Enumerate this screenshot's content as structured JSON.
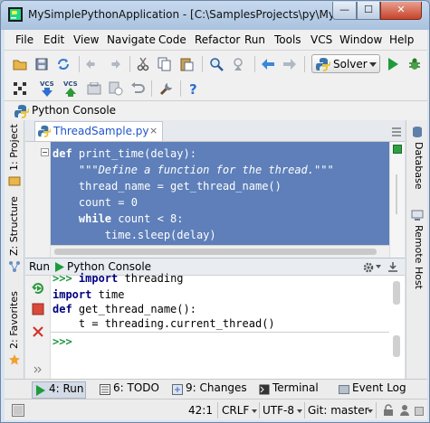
{
  "window": {
    "title": "MySimplePythonApplication - [C:\\SamplesProjects\\py\\MySim...",
    "minimize_label": "—",
    "maximize_label": "☐",
    "close_label": "✕"
  },
  "menu": [
    "File",
    "Edit",
    "View",
    "Navigate",
    "Code",
    "Refactor",
    "Run",
    "Tools",
    "VCS",
    "Window",
    "Help"
  ],
  "toolbar": {
    "run_config": "Solver",
    "vcs_label": "VCS"
  },
  "navbar": {
    "crumb": "Python Console"
  },
  "side_tabs": {
    "left": [
      "1: Project",
      "Z: Structure",
      "2: Favorites"
    ],
    "right": [
      "Database",
      "Remote Host"
    ]
  },
  "editor": {
    "tab_label": "ThreadSample.py",
    "tab_close": "×",
    "lines": [
      {
        "kw": "def",
        "rest": " print_time(delay):"
      },
      {
        "indent": "    ",
        "doc": "\"\"\"Define a function for the thread.\"\"\""
      },
      {
        "text": "    thread_name = get_thread_name()"
      },
      {
        "text": "    count = 0"
      },
      {
        "kw_indent": "    ",
        "kw": "while",
        "rest": " count < 8:"
      },
      {
        "text": "        time.sleep(delay)"
      }
    ]
  },
  "run_panel": {
    "title": "Run",
    "subtitle": "Python Console",
    "console_lines": [
      {
        "prompt": ">>> ",
        "kw": "import",
        "rest": " threading"
      },
      {
        "prompt": "",
        "kw": "import",
        "rest": " time"
      },
      {
        "prompt": "",
        "kw": "def",
        "rest": " get_thread_name():"
      },
      {
        "prompt": "",
        "kw": "",
        "rest": "    t = threading.current_thread()"
      }
    ],
    "input_prompt": ">>>"
  },
  "tool_tabs": [
    {
      "label": "4: Run",
      "active": true
    },
    {
      "label": "6: TODO",
      "active": false
    },
    {
      "label": "9: Changes",
      "active": false
    },
    {
      "label": "Terminal",
      "active": false
    },
    {
      "label": "Event Log",
      "active": false
    }
  ],
  "status": {
    "position": "42:1",
    "line_sep": "CRLF",
    "encoding": "UTF-8",
    "vcs_branch": "Git: master"
  },
  "colors": {
    "selection": "#5e7fb9",
    "accent_green": "#18963a",
    "link_blue": "#1f55c9"
  }
}
